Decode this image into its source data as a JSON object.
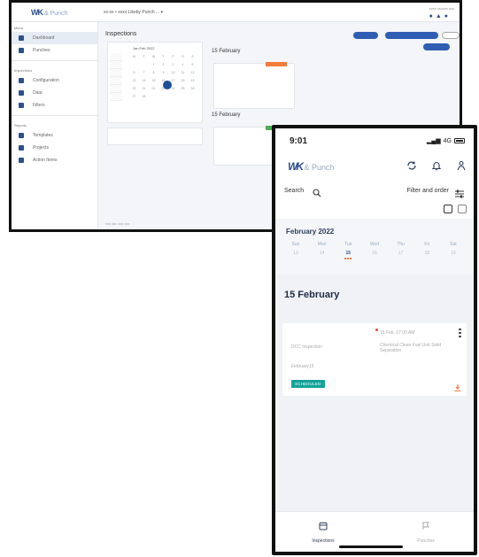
{
  "desktop": {
    "logo_mark": "WK",
    "logo_text": "& Punch",
    "breadcrumb": "xx-xx • xxxx   Likeby Punch ... ▾",
    "top_right": "xxxx xxxxxx xxx",
    "page_title": "Inspections",
    "calendar_month": "Jan Feb 2022",
    "weekdays": [
      "M",
      "T",
      "W",
      "T",
      "F",
      "S",
      "S"
    ],
    "calendar_days": [
      "",
      "",
      "1",
      "2",
      "3",
      "4",
      "5",
      "6",
      "7",
      "8",
      "9",
      "10",
      "11",
      "12",
      "13",
      "14",
      "15",
      "16",
      "17",
      "18",
      "19",
      "20",
      "21",
      "22",
      "23",
      "24",
      "25",
      "26",
      "27",
      "28",
      "",
      "",
      "",
      "",
      ""
    ],
    "date_headers": [
      "15 February",
      "15 February"
    ],
    "footer": "xxx xxx xxx xxx",
    "sidebar": {
      "section_1": "Menu",
      "items_1": [
        "Dashboard",
        "Punches"
      ],
      "section_2": "Inspections",
      "items_2": [
        "Configuration",
        "Data",
        "Filters"
      ],
      "section_3": "Reports",
      "items_3": [
        "Templates",
        "Projects",
        "Action Items"
      ]
    },
    "colors": {
      "accent": "#2f5eb3",
      "orange": "#f47b3a",
      "green": "#4caf50"
    }
  },
  "phone": {
    "time": "9:01",
    "signal_text": "4G",
    "logo_mark": "WK",
    "logo_text": "& Punch",
    "search_label": "Search",
    "filter_label": "Filter and order",
    "month": "February 2022",
    "weekdays": [
      "Sun",
      "Mon",
      "Tue",
      "Wed",
      "Thu",
      "Fri",
      "Sat"
    ],
    "days": [
      "13",
      "14",
      "15",
      "16",
      "17",
      "18",
      "19"
    ],
    "today_index": 2,
    "section_date": "15 February",
    "card": {
      "datetime": "15 Feb, 07:00 AM",
      "type": "DCC Inspection",
      "description": "Chemical Clean Fuel Unit Solid Separation",
      "id": "February15",
      "status": "SCHEDULED"
    },
    "tabs": [
      "Inspections",
      "Punches"
    ],
    "colors": {
      "accent": "#2d4f8e",
      "badge": "#14a39a",
      "dot": "#f47b3a",
      "alert": "#e24b3b"
    }
  }
}
